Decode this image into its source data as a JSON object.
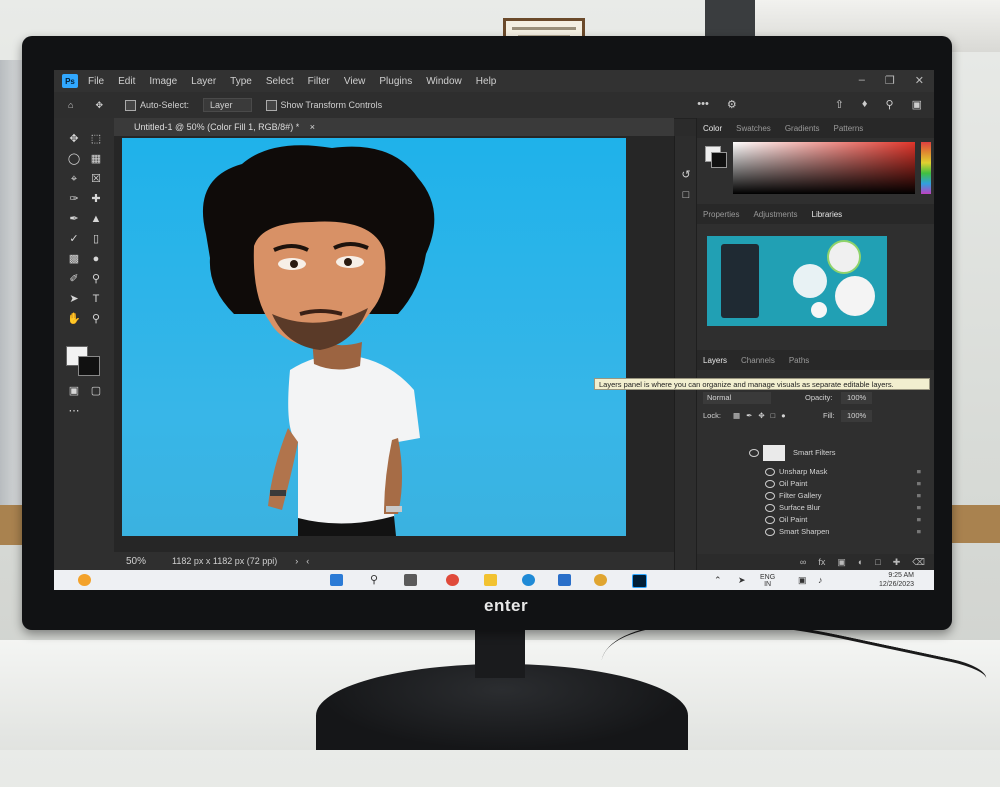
{
  "menubar": {
    "items": [
      "File",
      "Edit",
      "Image",
      "Layer",
      "Type",
      "Select",
      "Filter",
      "View",
      "Plugins",
      "Window",
      "Help"
    ],
    "ps_label": "Ps"
  },
  "options_bar": {
    "auto_select_label": "Auto-Select:",
    "auto_select_value": "Layer",
    "transform_label": "Show Transform Controls",
    "more": "•••"
  },
  "document": {
    "tab_title": "Untitled-1 @ 50% (Color Fill 1, RGB/8#) *",
    "close": "×",
    "zoom": "50%",
    "dimensions": "1182 px x 1182 px (72 ppi)"
  },
  "color_panel": {
    "tabs": [
      "Color",
      "Swatches",
      "Gradients",
      "Patterns"
    ],
    "active": "Color"
  },
  "properties_panel": {
    "tabs": [
      "Properties",
      "Adjustments",
      "Libraries"
    ],
    "active": "Libraries"
  },
  "layers_panel": {
    "tabs": [
      "Layers",
      "Channels",
      "Paths"
    ],
    "active": "Layers",
    "tooltip": "Layers panel is where you can organize and manage visuals as separate editable layers.",
    "blend_mode": "Normal",
    "opacity_label": "Opacity:",
    "opacity_value": "100%",
    "lock_label": "Lock:",
    "fill_label": "Fill:",
    "fill_value": "100%",
    "smart_filters_label": "Smart Filters",
    "filters": [
      "Unsharp Mask",
      "Oil Paint",
      "Filter Gallery",
      "Surface Blur",
      "Oil Paint",
      "Smart Sharpen"
    ]
  },
  "taskbar": {
    "lang": "ENG",
    "region": "IN",
    "time": "9:25 AM",
    "date": "12/26/2023"
  },
  "monitor": {
    "brand": "enter"
  },
  "colors": {
    "canvas_blue": "#2fb3e8",
    "ps_blue": "#31a8ff",
    "panel_dark": "#2f2f2f"
  }
}
